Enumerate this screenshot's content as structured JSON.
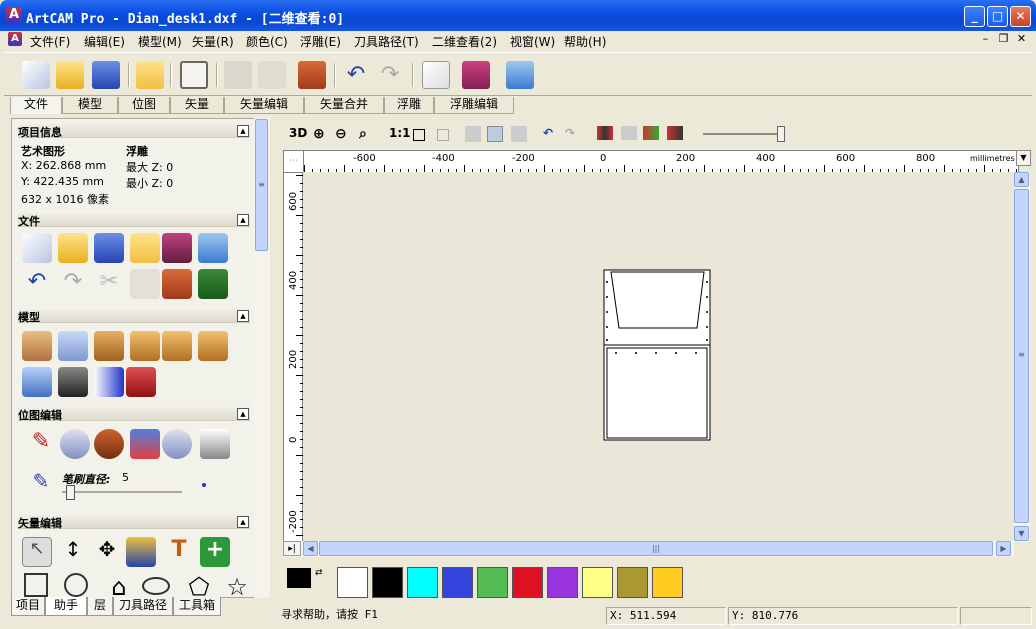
{
  "window": {
    "title": "ArtCAM Pro - Dian_desk1.dxf - [二维查看:0]"
  },
  "menu": [
    "文件(F)",
    "编辑(E)",
    "模型(M)",
    "矢量(R)",
    "颜色(C)",
    "浮雕(E)",
    "刀具路径(T)",
    "二维查看(2)",
    "视窗(W)",
    "帮助(H)"
  ],
  "top_tabs": [
    "文件",
    "模型",
    "位图",
    "矢量",
    "矢量编辑",
    "矢量合并",
    "浮雕",
    "浮雕编辑"
  ],
  "project": {
    "header": "项目信息",
    "art_label": "艺术图形",
    "relief_label": "浮雕",
    "x": "X: 262.868 mm",
    "y": "Y: 422.435 mm",
    "size": "632 x 1016 像素",
    "max": "最大  Z: 0",
    "min": "最小  Z: 0"
  },
  "sections": {
    "file": "文件",
    "model": "模型",
    "bitmap": "位图编辑",
    "vector": "矢量编辑"
  },
  "brush": {
    "label": "笔刷直径:",
    "value": "5",
    "slider_level": 0.03
  },
  "bottom_tabs": [
    "项目",
    "助手",
    "层",
    "刀具路径",
    "工具箱"
  ],
  "view_toolbar": {
    "mode_3d": "3D",
    "ratio": "1:1"
  },
  "ruler": {
    "unit": "millimetres",
    "h_ticks": [
      "-600",
      "-400",
      "-200",
      "0",
      "200",
      "400",
      "600",
      "800"
    ],
    "v_ticks": [
      "600",
      "400",
      "200",
      "0",
      "-200"
    ]
  },
  "palette": {
    "colors": [
      "#ffffff",
      "#000000",
      "#00ffff",
      "#3344dd",
      "#55bb55",
      "#dd1122",
      "#9933dd",
      "#ffff88",
      "#aa9933",
      "#ffcc22"
    ]
  },
  "status": {
    "help": "寻求帮助，请按 F1",
    "x": "X: 511.594",
    "y": "Y: 810.776"
  },
  "colors": {
    "titlebar": "#0a4fe0",
    "face": "#ece9d8",
    "canvas": "#eae7d9"
  }
}
